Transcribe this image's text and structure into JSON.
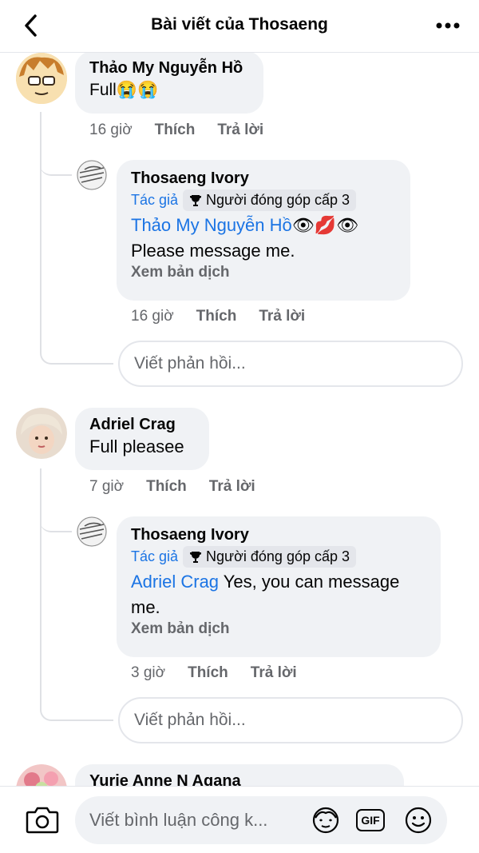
{
  "header": {
    "title": "Bài viết của Thosaeng",
    "back_icon": "chevron-left-icon",
    "more_icon": "more-horizontal-icon"
  },
  "comments": [
    {
      "author": "Thảo My Nguyễn Hồ",
      "text": "Full",
      "emoji": "😭😭",
      "time": "16 giờ",
      "like": "Thích",
      "reply": "Trả lời",
      "replies": [
        {
          "author": "Thosaeng Ivory",
          "author_badge": "Tác giả",
          "contrib_badge": "Người đóng góp cấp 3",
          "mention": "Thảo My Nguyễn Hồ",
          "mention_emoji": "👁💋👁",
          "text": "Please message me.",
          "see_translation": "Xem bản dịch",
          "time": "16 giờ",
          "like": "Thích",
          "reply": "Trả lời"
        }
      ],
      "reply_placeholder": "Viết phản hồi..."
    },
    {
      "author": "Adriel Crag",
      "text": "Full pleasee",
      "time": "7 giờ",
      "like": "Thích",
      "reply": "Trả lời",
      "replies": [
        {
          "author": "Thosaeng Ivory",
          "author_badge": "Tác giả",
          "contrib_badge": "Người đóng góp cấp 3",
          "mention": "Adriel Crag",
          "text_line1": "Yes, you can message",
          "text_line2": "me.",
          "see_translation": "Xem bản dịch",
          "time": "3 giờ",
          "like": "Thích",
          "reply": "Trả lời"
        }
      ],
      "reply_placeholder": "Viết phản hồi..."
    },
    {
      "author": "Yurie Anne N Agana"
    }
  ],
  "composer": {
    "placeholder": "Viết bình luận công k...",
    "camera_icon": "camera-icon",
    "avatar_icon": "avatar-sticker-icon",
    "gif_label": "GIF",
    "emoji_icon": "smiley-icon"
  },
  "colors": {
    "link": "#1b74e4",
    "bubble": "#f0f2f5",
    "muted": "#65676b"
  }
}
